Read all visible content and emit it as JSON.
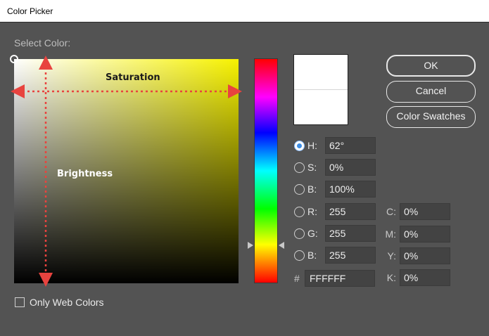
{
  "window": {
    "title": "Color Picker"
  },
  "select_color_label": "Select Color:",
  "field_overlay": {
    "saturation_label": "Saturation",
    "brightness_label": "Brightness"
  },
  "buttons": {
    "ok": "OK",
    "cancel": "Cancel",
    "swatches": "Color Swatches"
  },
  "hsb": [
    {
      "label": "H:",
      "value": "62°",
      "selected": true
    },
    {
      "label": "S:",
      "value": "0%",
      "selected": false
    },
    {
      "label": "B:",
      "value": "100%",
      "selected": false
    }
  ],
  "rgb": [
    {
      "label": "R:",
      "value": "255",
      "selected": false
    },
    {
      "label": "G:",
      "value": "255",
      "selected": false
    },
    {
      "label": "B:",
      "value": "255",
      "selected": false
    }
  ],
  "cmyk": [
    {
      "label": "C:",
      "value": "0%"
    },
    {
      "label": "M:",
      "value": "0%"
    },
    {
      "label": "Y:",
      "value": "0%"
    },
    {
      "label": "K:",
      "value": "0%"
    }
  ],
  "hex": {
    "label": "#",
    "value": "FFFFFF"
  },
  "web_colors": {
    "label": "Only Web Colors",
    "checked": false
  },
  "colors": {
    "new_color": "#ffffff",
    "current_color": "#ffffff",
    "hue_color": "#f7f200",
    "arrow_color": "#e8433f"
  }
}
